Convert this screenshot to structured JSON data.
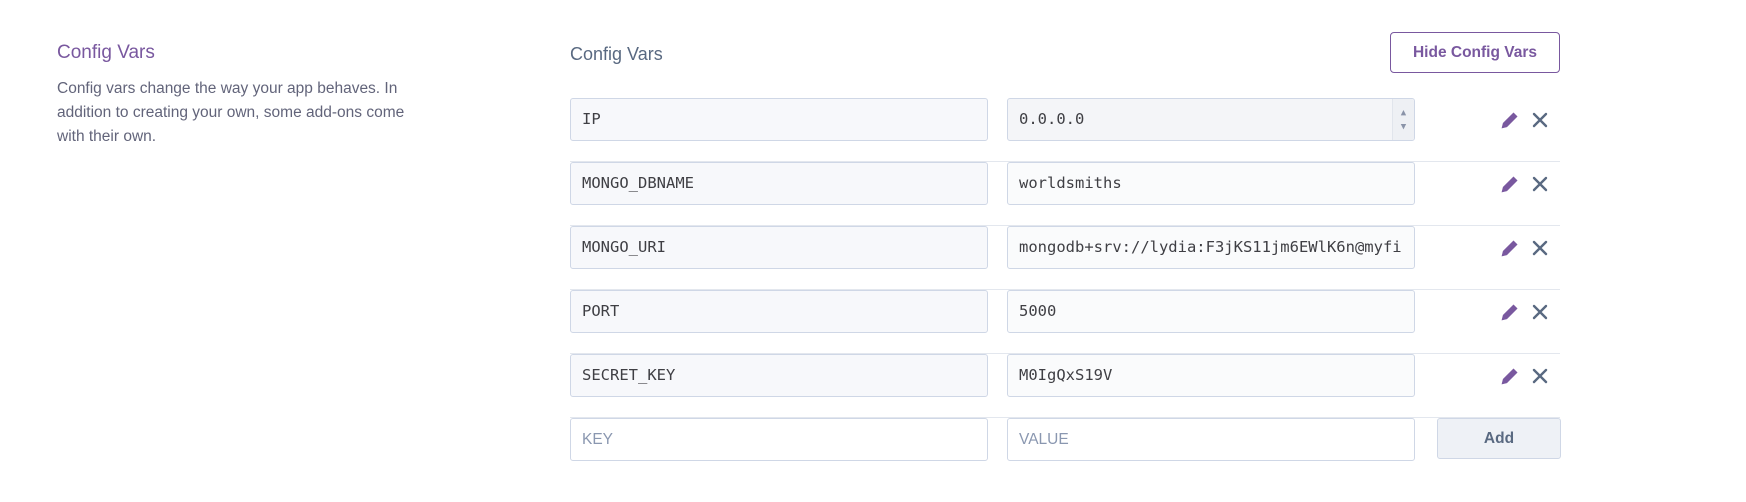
{
  "side": {
    "title": "Config Vars",
    "description": "Config vars change the way your app behaves. In addition to creating your own, some add-ons come with their own."
  },
  "main": {
    "title": "Config Vars",
    "hide_button": "Hide Config Vars"
  },
  "vars": [
    {
      "key": "IP",
      "value": "0.0.0.0"
    },
    {
      "key": "MONGO_DBNAME",
      "value": "worldsmiths"
    },
    {
      "key": "MONGO_URI",
      "value": "mongodb+srv://lydia:F3jKS11jm6EWlK6n@myfi"
    },
    {
      "key": "PORT",
      "value": "5000"
    },
    {
      "key": "SECRET_KEY",
      "value": "M0IgQxS19V"
    }
  ],
  "new_var": {
    "key_placeholder": "KEY",
    "value_placeholder": "VALUE",
    "add_button": "Add"
  },
  "icons": {
    "edit": "pencil-icon",
    "delete": "close-icon"
  },
  "colors": {
    "accent": "#79589f",
    "icon_dark": "#596981"
  }
}
